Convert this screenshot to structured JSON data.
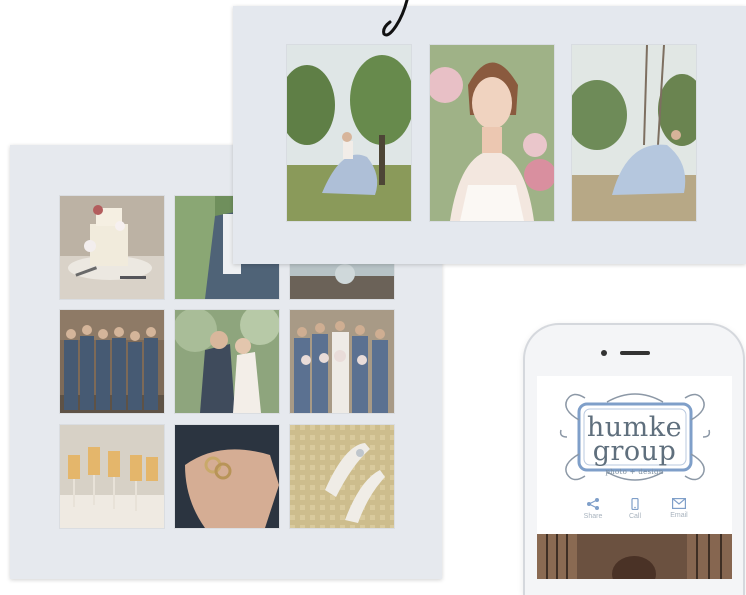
{
  "logo": {
    "line1": "humke",
    "line2": "group",
    "tagline": "photo + design"
  },
  "actions": [
    {
      "label": "Share",
      "icon": "share-icon"
    },
    {
      "label": "Call",
      "icon": "phone-icon"
    },
    {
      "label": "Email",
      "icon": "email-icon"
    }
  ],
  "colors": {
    "mat": "#e6e9ee",
    "accent": "#7f9fc9",
    "logo_text": "#5f6f7d"
  },
  "photos": {
    "front": [
      "bride-twirling-in-olive-grove",
      "bride-portrait-with-flowers",
      "bride-on-swing"
    ],
    "back": [
      "wedding-cake",
      "groom-in-suit",
      "floral-centerpiece",
      "groomsmen-group",
      "couple-embracing",
      "bridesmaids-group",
      "champagne-glasses",
      "wedding-rings-in-hand",
      "bridal-shoes"
    ]
  }
}
